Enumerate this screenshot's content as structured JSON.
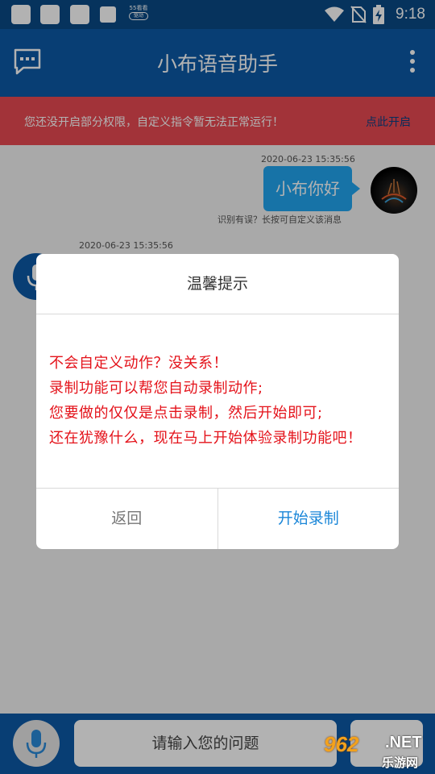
{
  "status_bar": {
    "time": "9:18",
    "badge_text": "55看看",
    "badge_sub": "驱动"
  },
  "app_bar": {
    "title": "小布语音助手",
    "left_icon": "chat-bubble-icon",
    "right_icon": "more-vert-icon"
  },
  "banner": {
    "text": "您还没开启部分权限，自定义指令暂无法正常运行！",
    "link": "点此开启"
  },
  "chat": {
    "messages": [
      {
        "timestamp": "2020-06-23 15:35:56",
        "text": "小布你好",
        "hint": "识别有误？长按可自定义该消息"
      },
      {
        "timestamp": "2020-06-23 15:35:56"
      }
    ]
  },
  "dialog": {
    "title": "温馨提示",
    "lines": [
      "不会自定义动作？没关系！",
      "录制功能可以帮您自动录制动作;",
      "您要做的仅仅是点击录制，然后开始即可;",
      "还在犹豫什么，现在马上开始体验录制功能吧！"
    ],
    "back_label": "返回",
    "start_label": "开始录制"
  },
  "input_bar": {
    "placeholder": "请输入您的问题"
  },
  "watermark": {
    "num": "962",
    "net": ".NET",
    "site": "乐游网"
  },
  "colors": {
    "primary": "#0c5aa6",
    "banner": "#e84a52",
    "bubble": "#22a5f0",
    "dialog_text": "#e4121a",
    "button_blue": "#1a86d8"
  }
}
